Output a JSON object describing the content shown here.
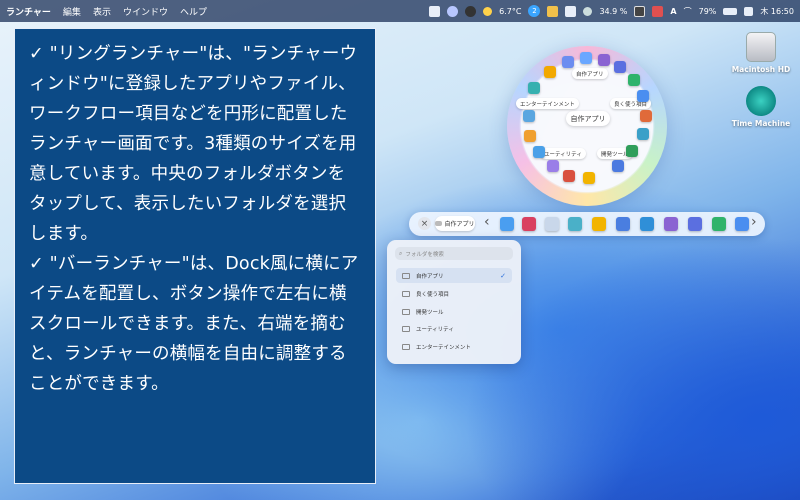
{
  "menubar": {
    "app_name": "ランチャー",
    "menus": [
      "編集",
      "表示",
      "ウインドウ",
      "ヘルプ"
    ],
    "status": {
      "weather": "6.7°C",
      "badge": "2",
      "memory": "34.9 %",
      "input_source": "A",
      "battery": "79%",
      "clock": "木 16:50"
    }
  },
  "panel": {
    "paragraph1": "✓ \"リングランチャー\"は、\"ランチャーウィンドウ\"に登録したアプリやファイル、ワークフロー項目などを円形に配置したランチャー画面です。3種類のサイズを用意しています。中央のフォルダボタンをタップして、表示したいフォルダを選択します。",
    "paragraph2": "✓ \"バーランチャー\"は、Dock風に横にアイテムを配置し、ボタン操作で左右に横スクロールできます。また、右端を摘むと、ランチャーの横幅を自由に調整することができます。"
  },
  "desktop": {
    "hd_label": "Macintosh HD",
    "tm_label": "Time Machine"
  },
  "ring": {
    "center_label": "自作アプリ",
    "labels": {
      "top": "自作アプリ",
      "left": "エンターテインメント",
      "right": "良く使う項目",
      "bottom_left": "ユーティリティ",
      "bottom_right": "開発ツール"
    }
  },
  "bar": {
    "close_label": "×",
    "folder_label": "自作アプリ",
    "left_chevron": "‹",
    "right_chevron": "›"
  },
  "dropdown": {
    "search_placeholder": "フォルダを検索",
    "items": [
      "自作アプリ",
      "良く使う項目",
      "開発ツール",
      "ユーティリティ",
      "エンターテインメント"
    ],
    "selected_mark": "✓"
  },
  "colors": {
    "panel_bg": "#0c4a86",
    "accent": "#2a6fdc"
  }
}
